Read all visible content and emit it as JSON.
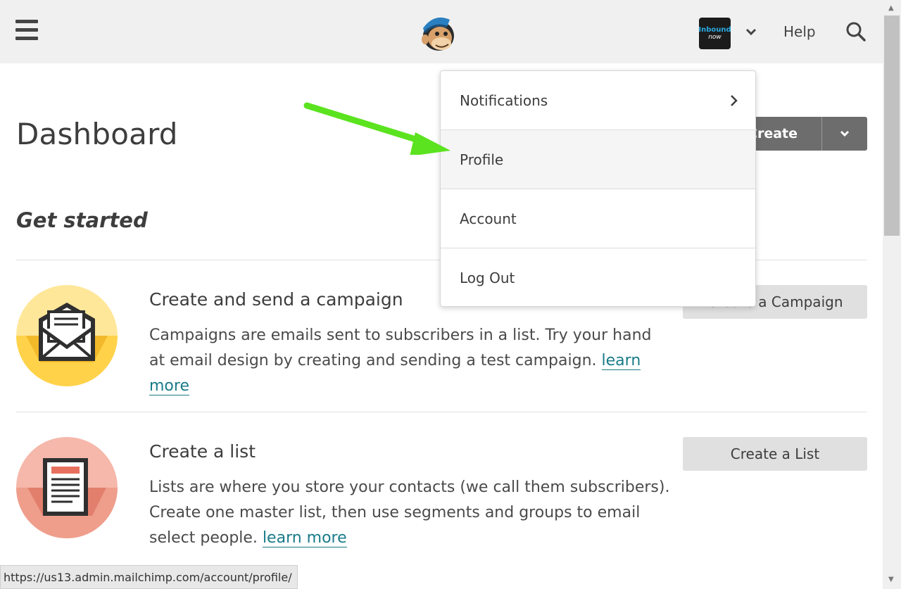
{
  "topbar": {
    "avatar_text_1": "Inbound",
    "avatar_text_2": "now",
    "help_label": "Help"
  },
  "page": {
    "title": "Dashboard",
    "create_campaign_split_label": "Create Campaign",
    "get_started": "Get started"
  },
  "cards": [
    {
      "title": "Create and send a campaign",
      "description": "Campaigns are emails sent to subscribers in a list. Try your hand at email design by creating and sending a test campaign.",
      "learn_more": "learn more",
      "button": "Create a Campaign",
      "icon": "envelope-icon",
      "color": "#ffe37a"
    },
    {
      "title": "Create a list",
      "description": "Lists are where you store your contacts (we call them subscribers). Create one master list, then use segments and groups to email select people.",
      "learn_more": "learn more",
      "button": "Create a List",
      "icon": "list-document-icon",
      "color": "#f0a190"
    }
  ],
  "dropdown": {
    "items": [
      {
        "label": "Notifications",
        "has_submenu": true
      },
      {
        "label": "Profile",
        "highlighted": true
      },
      {
        "label": "Account"
      },
      {
        "label": "Log Out"
      }
    ]
  },
  "annotation": {
    "arrow_color": "#5be31f"
  },
  "status_bar": {
    "url": "https://us13.admin.mailchimp.com/account/profile/"
  }
}
